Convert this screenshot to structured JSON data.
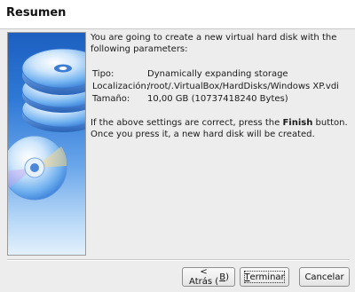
{
  "header": {
    "title": "Resumen"
  },
  "summary": {
    "intro": "You are going to create a new virtual hard disk with the following parameters:",
    "rows": [
      {
        "label": "Tipo:",
        "value": "Dynamically expanding storage"
      },
      {
        "label": "Localización:",
        "value": "/root/.VirtualBox/HardDisks/Windows XP.vdi"
      },
      {
        "label": "Tamaño:",
        "value": "10,00 GB (10737418240 Bytes)"
      }
    ],
    "confirm_before": "If the above settings are correct, press the ",
    "confirm_bold": "Finish",
    "confirm_after": " button. Once you press it, a new hard disk will be created."
  },
  "buttons": {
    "back_prefix": "< Atrás (",
    "back_mnemonic": "B",
    "back_suffix": ")",
    "finish_mnemonic": "T",
    "finish_rest": "erminar",
    "cancel": "Cancelar"
  },
  "colors": {
    "banner_top": "#1c5fc0",
    "banner_bottom": "#e3f0fc",
    "dialog_bg": "#ededed"
  },
  "icons": {
    "banner": "stacked-disks-icon"
  }
}
